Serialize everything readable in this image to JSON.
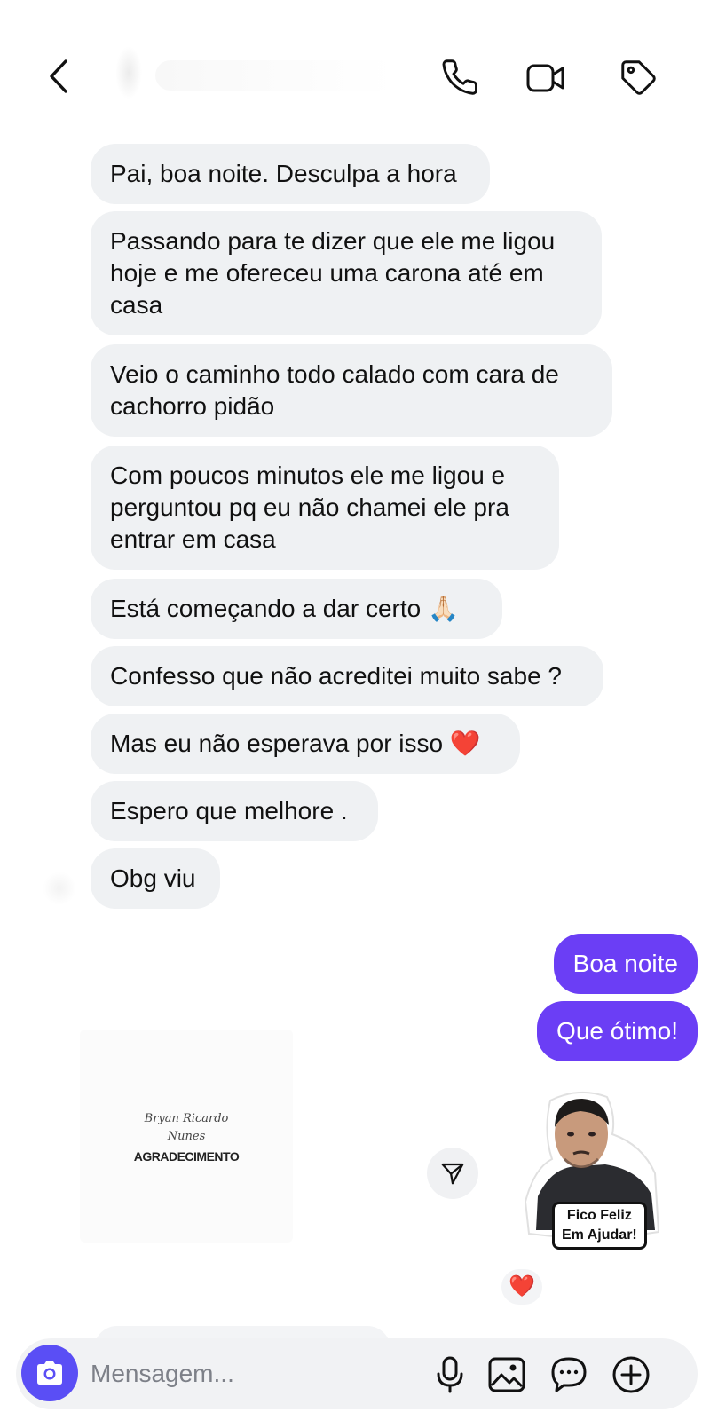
{
  "header": {
    "icons": [
      "back-icon",
      "phone-icon",
      "video-icon",
      "tag-icon"
    ]
  },
  "messages_received": [
    "Pai, boa noite. Desculpa a hora",
    "Passando para te dizer que ele me ligou hoje e me ofereceu uma carona até em casa",
    "Veio o caminho todo calado com cara de cachorro pidão",
    "Com poucos minutos ele me ligou e perguntou pq eu não chamei ele pra entrar em casa",
    "Está começando a dar certo 🙏🏻",
    "Confesso que não acreditei muito sabe ?",
    "Mas eu não esperava por isso ❤️",
    "Espero que melhore .",
    "Obg viu"
  ],
  "messages_sent": [
    "Boa noite",
    "Que ótimo!"
  ],
  "shared_post": {
    "signature_line1": "Bryan Ricardo",
    "signature_line2": "Nunes",
    "title": "AGRADECIMENTO"
  },
  "sticker": {
    "line1": "Fico Feliz",
    "line2": "Em Ajudar!"
  },
  "reaction": {
    "emoji": "❤️"
  },
  "composer": {
    "placeholder": "Mensagem...",
    "icons": [
      "camera-icon",
      "microphone-icon",
      "image-icon",
      "sticker-icon",
      "plus-icon"
    ]
  },
  "colors": {
    "sent_bubble": "#6b3ef5",
    "received_bubble": "#eff1f3",
    "camera_button": "#5a4ef5"
  }
}
